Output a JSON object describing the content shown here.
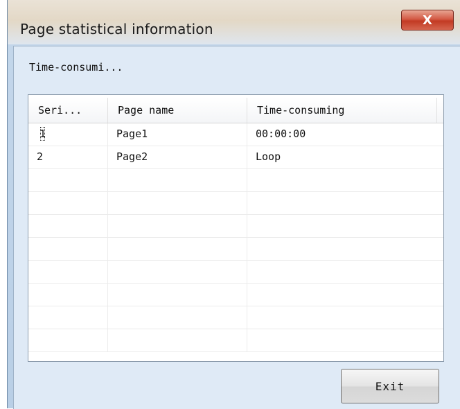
{
  "window": {
    "title": "Page statistical information",
    "close_label": "X"
  },
  "label": "Time-consumi...",
  "table": {
    "columns": [
      "Seri...",
      "Page name",
      "Time-consuming"
    ],
    "rows": [
      [
        "1",
        "Page1",
        "00:00:00"
      ],
      [
        "2",
        "Page2",
        "Loop"
      ]
    ],
    "empty_row_count": 8
  },
  "buttons": {
    "exit_label": "Exit"
  }
}
